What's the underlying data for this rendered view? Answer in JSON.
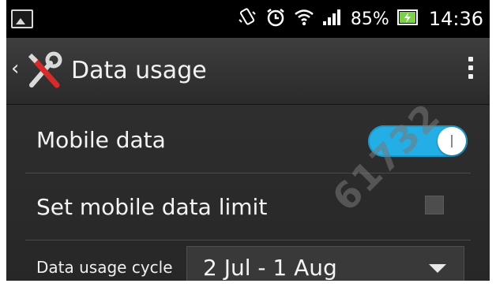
{
  "status_bar": {
    "battery_percent": "85%",
    "time": "14:36",
    "icons": [
      "image-icon",
      "vibrate-icon",
      "alarm-icon",
      "wifi-icon",
      "signal-icon",
      "battery-charging-icon"
    ]
  },
  "action_bar": {
    "title": "Data usage",
    "icons": [
      "back-chevron-icon",
      "tools-icon",
      "overflow-menu-icon"
    ]
  },
  "settings": {
    "mobile_data": {
      "label": "Mobile data",
      "enabled": true
    },
    "data_limit": {
      "label": "Set mobile data limit",
      "checked": false
    },
    "cycle": {
      "label": "Data usage cycle",
      "value": "2 Jul - 1 Aug"
    }
  },
  "watermark": "61732",
  "colors": {
    "toggle_on": "#24aee6",
    "background": "#2a2a2a"
  }
}
